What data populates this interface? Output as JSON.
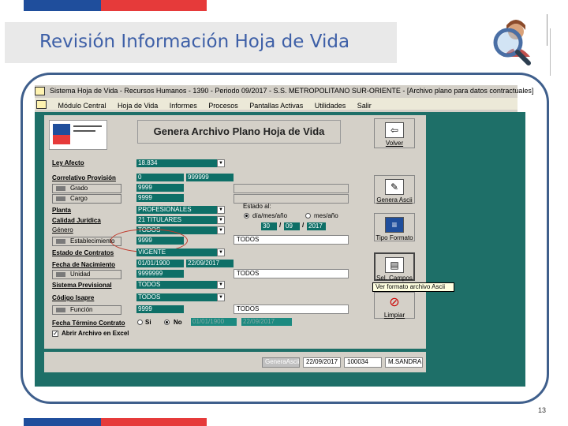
{
  "slide": {
    "title": "Revisión Información Hoja de Vida",
    "page_number": "13",
    "brand_colors": {
      "blue": "#1f4e9c",
      "red": "#e63a3a",
      "teal": "#1e6f68"
    }
  },
  "app": {
    "window_title": "Sistema Hoja de Vida - Recursos Humanos - 1390 - Periodo 09/2017 - S.S. METROPOLITANO SUR-ORIENTE - [Archivo plano para datos contractuales]",
    "menu": [
      "Módulo Central",
      "Hoja de Vida",
      "Informes",
      "Procesos",
      "Pantallas Activas",
      "Utilidades",
      "Salir"
    ]
  },
  "form": {
    "header": "Genera Archivo Plano Hoja de Vida",
    "ley_afecto": {
      "label": "Ley Afecto",
      "value": "18.834"
    },
    "correlativo": {
      "label": "Correlativo Provisión",
      "from": "0",
      "to": "999999"
    },
    "grado_button": "Grado",
    "grado_value": "9999",
    "cargo_button": "Cargo",
    "cargo_value": "9999",
    "planta": {
      "label": "Planta",
      "value": "PROFESIONALES"
    },
    "calidad": {
      "label": "Calidad Jurídica",
      "value": "21 TITULARES"
    },
    "genero": {
      "label": "Género",
      "value": "TODOS"
    },
    "establecimiento_button": "Establecimiento",
    "establecimiento_value": "9999",
    "establecimiento_desc": "TODOS",
    "estado_contrato": {
      "label": "Estado de Contratos",
      "value": "VIGENTE"
    },
    "fecha_nacimiento": {
      "label": "Fecha de Nacimiento",
      "from": "01/01/1900",
      "to": "22/09/2017"
    },
    "unidad_button": "Unidad",
    "unidad_value": "9999999",
    "unidad_desc": "TODOS",
    "sistema_previsional": {
      "label": "Sistema Previsional",
      "value": "TODOS"
    },
    "codigo_isapre": {
      "label": "Código Isapre",
      "value": "TODOS"
    },
    "funcion_button": "Función",
    "funcion_value": "9999",
    "funcion_desc": "TODOS",
    "fecha_termino": {
      "label": "Fecha Término Contrato",
      "si": "Si",
      "no": "No",
      "from": "01/01/1900",
      "to": "22/09/2017"
    },
    "abrir_excel": "Abrir Archivo en Excel",
    "estado_al": {
      "label": "Estado al:",
      "opt1": "día/mes/año",
      "opt2": "mes/año",
      "day": "30",
      "month": "09",
      "year": "2017",
      "sep": "/"
    }
  },
  "side_buttons": {
    "volver": "Volver",
    "genera_ascii": "Genera Ascii",
    "tipo_formato": "Tipo Formato",
    "sel_campos": "Sel. Campos",
    "tooltip": "Ver formato archivo Ascii",
    "limpiar": "Limpiar"
  },
  "status_bar": {
    "item1": "GeneraAscii",
    "item2": "22/09/2017",
    "item3": "100034",
    "item4": "M.SANDRA"
  }
}
